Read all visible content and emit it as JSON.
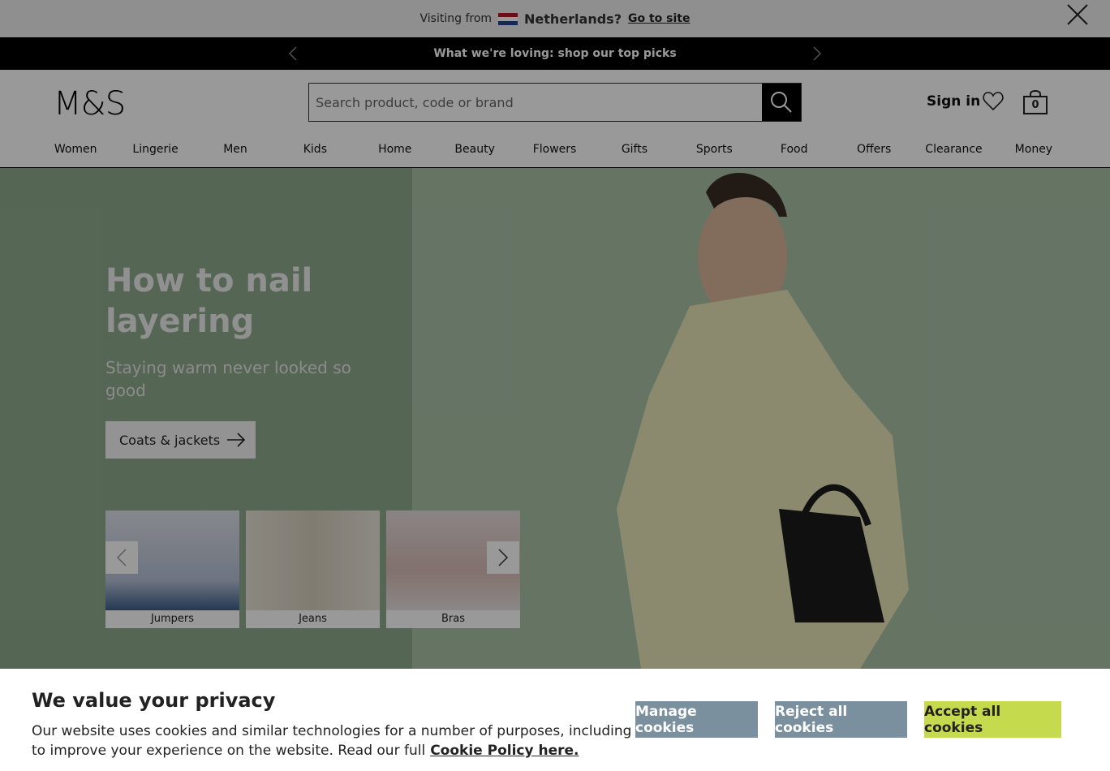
{
  "geo_banner": {
    "visiting_label": "Visiting from",
    "country": "Netherlands?",
    "link_label": "Go to site"
  },
  "promo": {
    "text": "What we're loving: shop our top picks"
  },
  "header": {
    "logo": "M&S",
    "search_placeholder": "Search product, code or brand",
    "signin_label": "Sign in",
    "bag_count": "0"
  },
  "nav": [
    "Women",
    "Lingerie",
    "Men",
    "Kids",
    "Home",
    "Beauty",
    "Flowers",
    "Gifts",
    "Sports",
    "Food",
    "Offers",
    "Clearance",
    "Money"
  ],
  "hero": {
    "title": "How to nail layering",
    "subtitle": "Staying warm never looked so good",
    "cta_label": "Coats & jackets",
    "tiles": [
      {
        "label": "Jumpers"
      },
      {
        "label": "Jeans"
      },
      {
        "label": "Bras"
      }
    ]
  },
  "cookie": {
    "title": "We value your privacy",
    "body": "Our website uses cookies and similar technologies for a number of purposes, including to improve your experience on the website. Read our full",
    "policy_link": "Cookie Policy here.",
    "manage_label": "Manage cookies",
    "reject_label": "Reject all cookies",
    "accept_label": "Accept all cookies"
  },
  "colors": {
    "accept": "#c5da4c",
    "secondary_btn": "#7a909f",
    "hero_panel": "#8fab8d"
  }
}
